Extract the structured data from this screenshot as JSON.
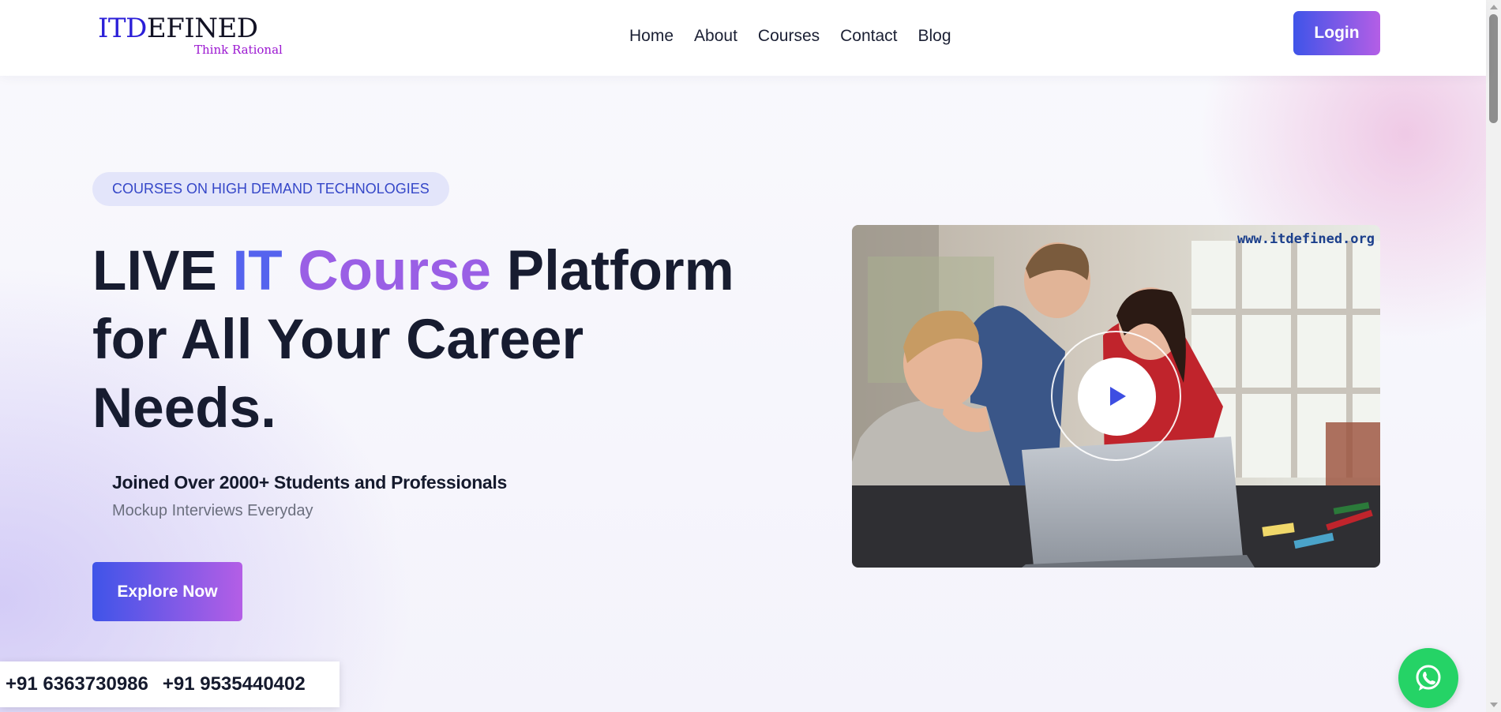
{
  "brand": {
    "logo_first": "ITD",
    "logo_rest": "EFINED",
    "tagline": "Think Rational"
  },
  "nav": {
    "items": [
      "Home",
      "About",
      "Courses",
      "Contact",
      "Blog"
    ]
  },
  "header": {
    "login_label": "Login"
  },
  "hero": {
    "badge": "COURSES ON HIGH DEMAND TECHNOLOGIES",
    "headline_part1": "LIVE",
    "headline_it": "IT",
    "headline_course": "Course",
    "headline_part2": "Platform for All Your Career Needs.",
    "joined": "Joined Over 2000+ Students and Professionals",
    "subtext": "Mockup Interviews Everyday",
    "cta_label": "Explore Now"
  },
  "video": {
    "watermark": "www.itdefined.org",
    "play_icon": "play-icon"
  },
  "contact": {
    "phone1": "+91 6363730986",
    "phone2": "+91 9535440402"
  },
  "floating": {
    "whatsapp_icon": "whatsapp-icon"
  },
  "colors": {
    "accent_start": "#3f54e8",
    "accent_end": "#b45ee6",
    "text_dark": "#171c30",
    "badge_bg": "#e3e5fa",
    "whatsapp_green": "#25d366"
  }
}
